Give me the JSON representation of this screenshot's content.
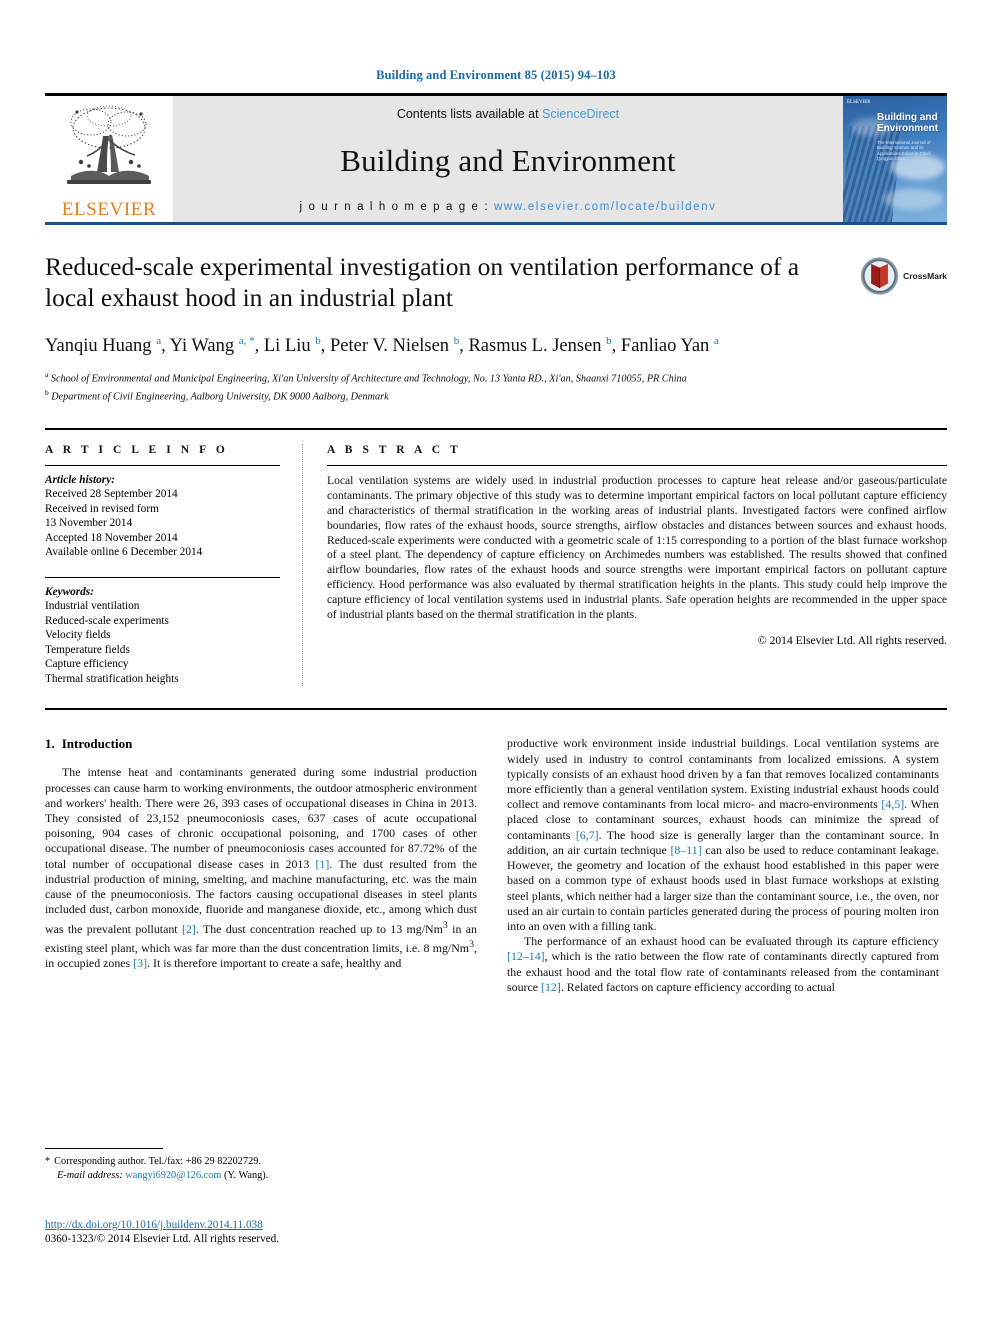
{
  "running_head": "Building and Environment 85 (2015) 94–103",
  "masthead": {
    "publisher_name": "ELSEVIER",
    "contents_prefix": "Contents lists available at ",
    "contents_link": "ScienceDirect",
    "journal_title": "Building and Environment",
    "homepage_prefix": "j o u r n a l   h o m e p a g e :  ",
    "homepage_url": "www.elsevier.com/locate/buildenv",
    "cover_title": "Building and Environment",
    "cover_subtitle": "The International Journal of Building Science and its Applications Editor-in-Chief: Qingyan Chen",
    "cover_logo_text": "ELSEVIER",
    "colors": {
      "link_blue": "#3f8fd0",
      "rule_blue": "#15538c",
      "elsevier_orange": "#E87D1E",
      "banner_gray": "#e6e6e6"
    }
  },
  "article": {
    "title": "Reduced-scale experimental investigation on ventilation performance of a local exhaust hood in an industrial plant",
    "crossmark_label": "CrossMark",
    "authors_html": "Yanqiu Huang <sup>a</sup>, Yi Wang <sup>a, *</sup>, Li Liu <sup>b</sup>, Peter V. Nielsen <sup>b</sup>, Rasmus L. Jensen <sup>b</sup>, Fanliao Yan <sup>a</sup>",
    "affiliation_a": "School of Environmental and Municipal Engineering, Xi'an University of Architecture and Technology, No. 13 Yanta RD., Xi'an, Shaanxi 710055, PR China",
    "affiliation_b": "Department of Civil Engineering, Aalborg University, DK 9000 Aalborg, Denmark"
  },
  "article_info": {
    "heading": "A R T I C L E   I N F O",
    "history_label": "Article history:",
    "history": [
      "Received 28 September 2014",
      "Received in revised form",
      "13 November 2014",
      "Accepted 18 November 2014",
      "Available online 6 December 2014"
    ],
    "keywords_label": "Keywords:",
    "keywords": [
      "Industrial ventilation",
      "Reduced-scale experiments",
      "Velocity fields",
      "Temperature fields",
      "Capture efficiency",
      "Thermal stratification heights"
    ]
  },
  "abstract": {
    "heading": "A B S T R A C T",
    "text": "Local ventilation systems are widely used in industrial production processes to capture heat release and/or gaseous/particulate contaminants. The primary objective of this study was to determine important empirical factors on local pollutant capture efficiency and characteristics of thermal stratification in the working areas of industrial plants. Investigated factors were confined airflow boundaries, flow rates of the exhaust hoods, source strengths, airflow obstacles and distances between sources and exhaust hoods. Reduced-scale experiments were conducted with a geometric scale of 1:15 corresponding to a portion of the blast furnace workshop of a steel plant. The dependency of capture efficiency on Archimedes numbers was established. The results showed that confined airflow boundaries, flow rates of the exhaust hoods and source strengths were important empirical factors on pollutant capture efficiency. Hood performance was also evaluated by thermal stratification heights in the plants. This study could help improve the capture efficiency of local ventilation systems used in industrial plants. Safe operation heights are recommended in the upper space of industrial plants based on the thermal stratification in the plants.",
    "copyright": "© 2014 Elsevier Ltd. All rights reserved."
  },
  "body": {
    "section_number": "1.",
    "section_title": "Introduction",
    "left_paragraph_1_html": "The intense heat and contaminants generated during some industrial production processes can cause harm to working environments, the outdoor atmospheric environment and workers' health. There were 26, 393 cases of occupational diseases in China in 2013. They consisted of 23,152 pneumoconiosis cases, 637 cases of acute occupational poisoning, 904 cases of chronic occupational poisoning, and 1700 cases of other occupational disease. The number of pneumoconiosis cases accounted for 87.72% of the total number of occupational disease cases in 2013 <span class=\"ref\">[1]</span>. The dust resulted from the industrial production of mining, smelting, and machine manufacturing, etc. was the main cause of the pneumoconiosis. The factors causing occupational diseases in steel plants included dust, carbon monoxide, fluoride and manganese dioxide, etc., among which dust was the prevalent pollutant <span class=\"ref\">[2]</span>. The dust concentration reached up to 13 mg/Nm<sup>3</sup> in an existing steel plant, which was far more than the dust concentration limits, i.e. 8 mg/Nm<sup>3</sup>, in occupied zones <span class=\"ref\">[3]</span>. It is therefore important to create a safe, healthy and",
    "right_paragraph_1_html": "productive work environment inside industrial buildings. Local ventilation systems are widely used in industry to control contaminants from localized emissions. A system typically consists of an exhaust hood driven by a fan that removes localized contaminants more efficiently than a general ventilation system. Existing industrial exhaust hoods could collect and remove contaminants from local micro- and macro-environments <span class=\"ref\">[4,5]</span>. When placed close to contaminant sources, exhaust hoods can minimize the spread of contaminants <span class=\"ref\">[6,7]</span>. The hood size is generally larger than the contaminant source. In addition, an air curtain technique <span class=\"ref\">[8–11]</span> can also be used to reduce contaminant leakage. However, the geometry and location of the exhaust hood established in this paper were based on a common type of exhaust hoods used in blast furnace workshops at existing steel plants, which neither had a larger size than the contaminant source, i.e., the oven, nor used an air curtain to contain particles generated during the process of pouring molten iron into an oven with a filling tank.",
    "right_paragraph_2_html": "The performance of an exhaust hood can be evaluated through its capture efficiency <span class=\"ref\">[12–14]</span>, which is the ratio between the flow rate of contaminants directly captured from the exhaust hood and the total flow rate of contaminants released from the contaminant source <span class=\"ref\">[12]</span>. Related factors on capture efficiency according to actual"
  },
  "footer": {
    "corresponding_star": "*",
    "corresponding_text": "Corresponding author. Tel./fax: +86 29 82202729.",
    "email_label": "E-mail address:",
    "email": "wangyi6920@126.com",
    "email_suffix": "(Y. Wang).",
    "doi_url": "http://dx.doi.org/10.1016/j.buildenv.2014.11.038",
    "issn_line": "0360-1323/© 2014 Elsevier Ltd. All rights reserved."
  }
}
